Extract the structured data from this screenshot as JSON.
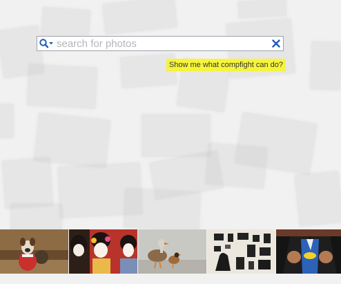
{
  "search": {
    "placeholder": "search for photos",
    "value": ""
  },
  "demo_link": {
    "label": "Show me what compfight can do?"
  },
  "filmstrip": {
    "thumbnails": [
      {
        "subject": "dog in costume"
      },
      {
        "subject": "geisha women"
      },
      {
        "subject": "two birds"
      },
      {
        "subject": "camera gear flatlay"
      },
      {
        "subject": "superhero shirt reveal"
      }
    ]
  },
  "colors": {
    "highlight": "#f6f43b",
    "icon_blue": "#1d5bb8",
    "background": "#f1f1f1"
  }
}
